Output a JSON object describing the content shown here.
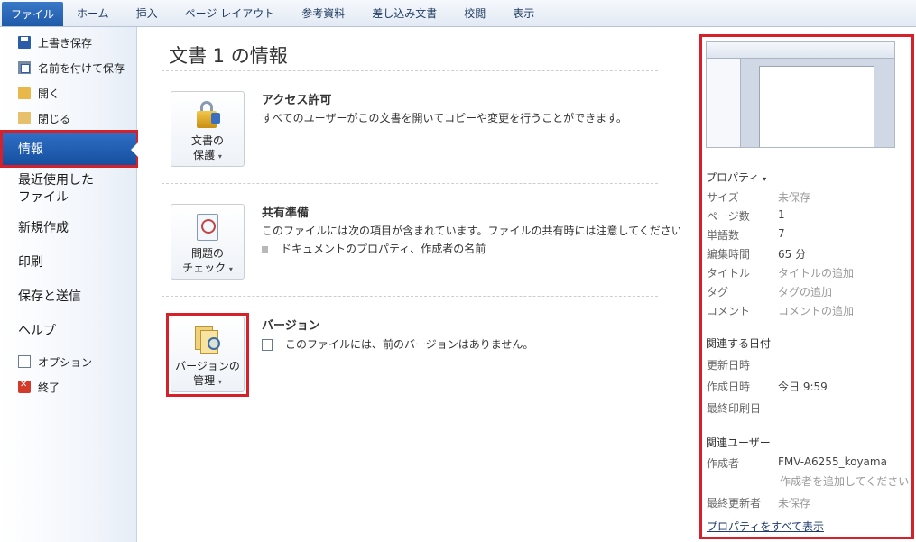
{
  "tabs": [
    "ファイル",
    "ホーム",
    "挿入",
    "ページ レイアウト",
    "参考資料",
    "差し込み文書",
    "校閲",
    "表示"
  ],
  "left_nav": {
    "save": "上書き保存",
    "save_as": "名前を付けて保存",
    "open": "開く",
    "close": "閉じる",
    "info": "情報",
    "recent_line1": "最近使用した",
    "recent_line2": "ファイル",
    "new": "新規作成",
    "print": "印刷",
    "save_send": "保存と送信",
    "help": "ヘルプ",
    "options": "オプション",
    "exit": "終了"
  },
  "main": {
    "title": "文書 1 の情報",
    "protect": {
      "btn_line1": "文書の",
      "btn_line2": "保護",
      "heading": "アクセス許可",
      "desc": "すべてのユーザーがこの文書を開いてコピーや変更を行うことができます。"
    },
    "check": {
      "btn_line1": "問題の",
      "btn_line2": "チェック",
      "heading": "共有準備",
      "desc": "このファイルには次の項目が含まれています。ファイルの共有時には注意してください。",
      "bullet": "ドキュメントのプロパティ、作成者の名前"
    },
    "versions": {
      "btn_line1": "バージョンの",
      "btn_line2": "管理",
      "heading": "バージョン",
      "desc": "このファイルには、前のバージョンはありません。"
    }
  },
  "properties": {
    "header": "プロパティ",
    "rows": [
      {
        "key": "サイズ",
        "value": "未保存",
        "muted": true
      },
      {
        "key": "ページ数",
        "value": "1",
        "muted": false
      },
      {
        "key": "単語数",
        "value": "7",
        "muted": false
      },
      {
        "key": "編集時間",
        "value": "65 分",
        "muted": false
      },
      {
        "key": "タイトル",
        "value": "タイトルの追加",
        "muted": true
      },
      {
        "key": "タグ",
        "value": "タグの追加",
        "muted": true
      },
      {
        "key": "コメント",
        "value": "コメントの追加",
        "muted": true
      }
    ],
    "dates_header": "関連する日付",
    "dates": [
      {
        "key": "更新日時",
        "value": ""
      },
      {
        "key": "作成日時",
        "value": "今日 9:59"
      },
      {
        "key": "最終印刷日",
        "value": ""
      }
    ],
    "people_header": "関連ユーザー",
    "author_key": "作成者",
    "author_value": "FMV-A6255_koyama",
    "add_author": "作成者を追加してください",
    "last_modified_key": "最終更新者",
    "last_modified_value": "未保存",
    "show_all": "プロパティをすべて表示"
  }
}
